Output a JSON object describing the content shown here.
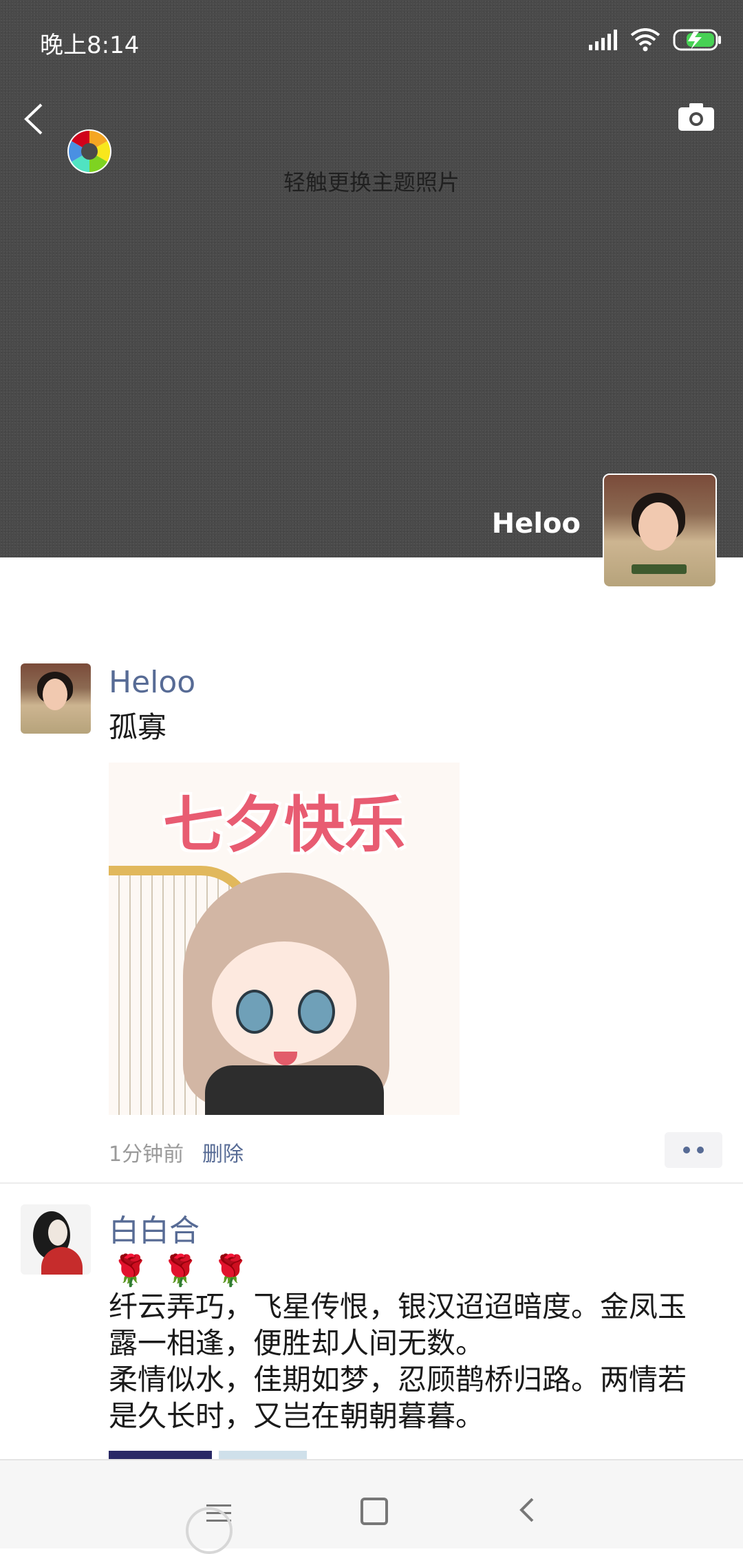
{
  "status_bar": {
    "time": "晚上8:14"
  },
  "cover": {
    "hint": "轻触更换主题照片",
    "user_name": "Heloo"
  },
  "posts": [
    {
      "nickname": "Heloo",
      "text": "孤寡",
      "sticker_text": "七夕快乐",
      "time": "1分钟前",
      "delete_label": "删除"
    },
    {
      "nickname": "白白合",
      "emoji": "🌹🌹🌹",
      "lines": [
        "纤云弄巧，飞星传恨，银汉迢迢暗度。金凤玉",
        "露一相逢，便胜却人间无数。",
        "柔情似水，佳期如梦，忍顾鹊桥归路。两情若",
        "是久长时，又岂在朝朝暮暮。"
      ]
    }
  ],
  "colors": {
    "link": "#576b95",
    "cover_bg": "#4a4a4a"
  },
  "icons": [
    "back-icon",
    "camera-icon",
    "aperture-icon",
    "signal-icon",
    "wifi-icon",
    "battery-icon",
    "menu-icon",
    "home-icon",
    "nav-back-icon"
  ]
}
